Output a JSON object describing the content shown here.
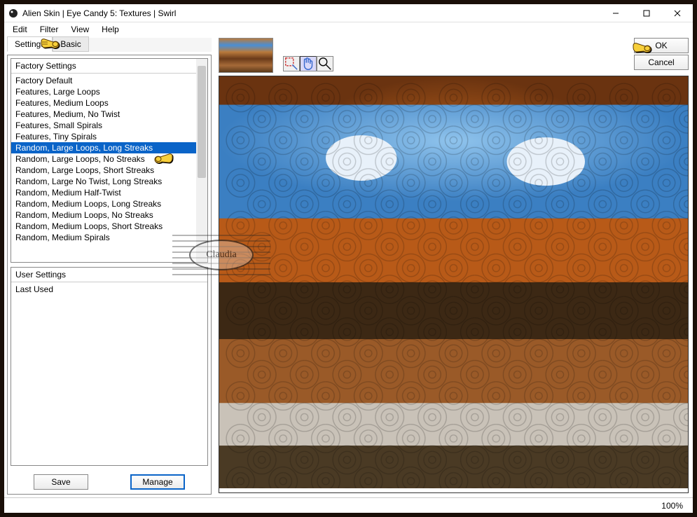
{
  "window": {
    "title": "Alien Skin | Eye Candy 5: Textures | Swirl"
  },
  "menubar": [
    "Edit",
    "Filter",
    "View",
    "Help"
  ],
  "tabs": {
    "settings": "Settings",
    "basic": "Basic"
  },
  "factory": {
    "header": "Factory Settings",
    "items": [
      "Factory Default",
      "Features, Large Loops",
      "Features, Medium Loops",
      "Features, Medium, No Twist",
      "Features, Small Spirals",
      "Features, Tiny Spirals",
      "Random, Large Loops, Long Streaks",
      "Random, Large Loops, No Streaks",
      "Random, Large Loops, Short Streaks",
      "Random, Large No Twist, Long Streaks",
      "Random, Medium Half-Twist",
      "Random, Medium Loops, Long Streaks",
      "Random, Medium Loops, No Streaks",
      "Random, Medium Loops, Short Streaks",
      "Random, Medium Spirals"
    ],
    "selected_index": 6
  },
  "user": {
    "header": "User Settings",
    "items": [
      "Last Used"
    ]
  },
  "buttons": {
    "save": "Save",
    "manage": "Manage",
    "ok": "OK",
    "cancel": "Cancel"
  },
  "status": {
    "zoom": "100%"
  },
  "watermark": "Claudia"
}
